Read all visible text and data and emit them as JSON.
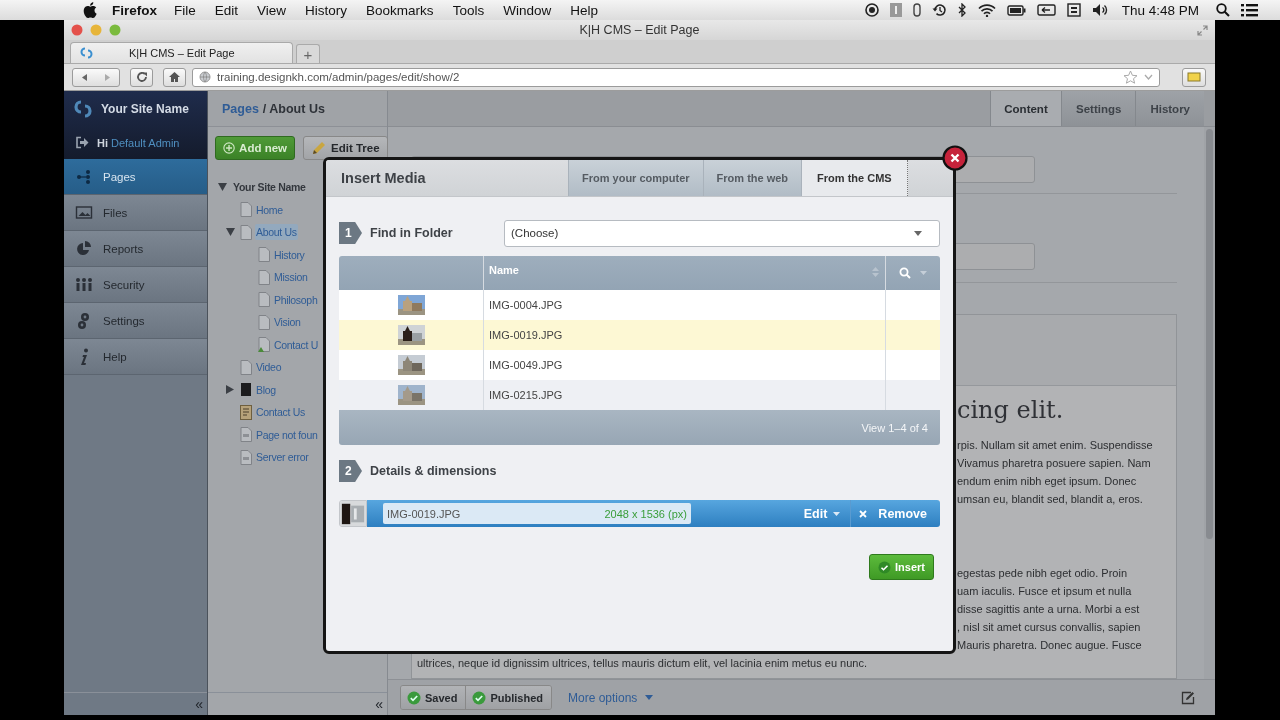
{
  "menubar": {
    "app": "Firefox",
    "menus": [
      "File",
      "Edit",
      "View",
      "History",
      "Bookmarks",
      "Tools",
      "Window",
      "Help"
    ],
    "clock": "Thu 4:48 PM"
  },
  "browser": {
    "title": "K|H CMS – Edit Page",
    "tab": "K|H CMS – Edit Page",
    "new_tab": "+",
    "url": "training.designkh.com/admin/pages/edit/show/2"
  },
  "sidebar": {
    "site_name": "Your Site Name",
    "greeting": "Hi",
    "user": "Default Admin",
    "collapse": "«",
    "items": [
      {
        "label": "Pages",
        "kind": "pages",
        "selected": true
      },
      {
        "label": "Files",
        "kind": "files",
        "selected": false
      },
      {
        "label": "Reports",
        "kind": "reports",
        "selected": false
      },
      {
        "label": "Security",
        "kind": "security",
        "selected": false
      },
      {
        "label": "Settings",
        "kind": "settings",
        "selected": false
      },
      {
        "label": "Help",
        "kind": "help",
        "selected": false
      }
    ]
  },
  "tree_panel": {
    "breadcrumb": [
      {
        "label": "Pages",
        "kind": "link"
      },
      {
        "label": "/ About Us",
        "kind": "current"
      }
    ],
    "buttons": [
      {
        "label": "Add new",
        "kind": "add"
      },
      {
        "label": "Edit Tree",
        "kind": "edit"
      }
    ],
    "collapse": "«",
    "tree": [
      {
        "label": "Your Site Name",
        "kind": "root",
        "expanded": true,
        "selected": false,
        "children": [
          {
            "label": "Home",
            "kind": "page",
            "selected": false
          },
          {
            "label": "About Us",
            "kind": "page",
            "expanded": true,
            "selected": true,
            "children": [
              {
                "label": "History",
                "kind": "page",
                "selected": false
              },
              {
                "label": "Mission",
                "kind": "page",
                "selected": false
              },
              {
                "label": "Philosoph",
                "kind": "page",
                "selected": false
              },
              {
                "label": "Vision",
                "kind": "page",
                "selected": false
              },
              {
                "label": "Contact U",
                "kind": "linked",
                "selected": false
              }
            ]
          },
          {
            "label": "Video",
            "kind": "page",
            "selected": false
          },
          {
            "label": "Blog",
            "kind": "blog",
            "expanded": false,
            "selected": false
          },
          {
            "label": "Contact Us",
            "kind": "form",
            "selected": false
          },
          {
            "label": "Page not foun",
            "kind": "error",
            "selected": false
          },
          {
            "label": "Server error",
            "kind": "error",
            "selected": false
          }
        ]
      }
    ]
  },
  "main": {
    "tabs": [
      {
        "label": "Content",
        "selected": true
      },
      {
        "label": "Settings",
        "selected": false
      },
      {
        "label": "History",
        "selected": false
      }
    ],
    "editor": {
      "heading": "cing elit.",
      "paragraphs": [
        [
          "rpis. Nullam sit amet enim. Suspendisse",
          "Vivamus pharetra posuere sapien. Nam",
          "endum enim nibh eget ipsum. Donec",
          "umsan eu, blandit sed, blandit a, eros."
        ],
        [
          "egestas pede nibh eget odio. Proin",
          "uam iaculis. Fusce et ipsum et nulla",
          "disse sagittis ante a urna. Morbi a est",
          ", nisl sit amet cursus convallis, sapien",
          "Mauris pharetra. Donec augue. Fusce"
        ]
      ],
      "last_line": "ultrices, neque id dignissim ultrices, tellus mauris dictum elit, vel lacinia enim metus eu nunc."
    },
    "footer": {
      "statuses": [
        "Saved",
        "Published"
      ],
      "more_options": "More options"
    }
  },
  "modal": {
    "title": "Insert Media",
    "tabs": [
      {
        "label": "From your computer",
        "selected": false
      },
      {
        "label": "From the web",
        "selected": false
      },
      {
        "label": "From the CMS",
        "selected": true
      }
    ],
    "step1": {
      "number": "1",
      "label": "Find in Folder",
      "select": "(Choose)"
    },
    "table": {
      "column": "Name",
      "footer": "View 1–4 of 4",
      "rows": [
        {
          "name": "IMG-0004.JPG",
          "selected": false
        },
        {
          "name": "IMG-0019.JPG",
          "selected": true
        },
        {
          "name": "IMG-0049.JPG",
          "selected": false
        },
        {
          "name": "IMG-0215.JPG",
          "selected": false
        }
      ]
    },
    "step2": {
      "number": "2",
      "label": "Details & dimensions"
    },
    "file": {
      "name": "IMG-0019.JPG",
      "dimensions": "2048 x 1536 (px)",
      "edit": "Edit",
      "remove": "Remove"
    },
    "insert": "Insert"
  }
}
